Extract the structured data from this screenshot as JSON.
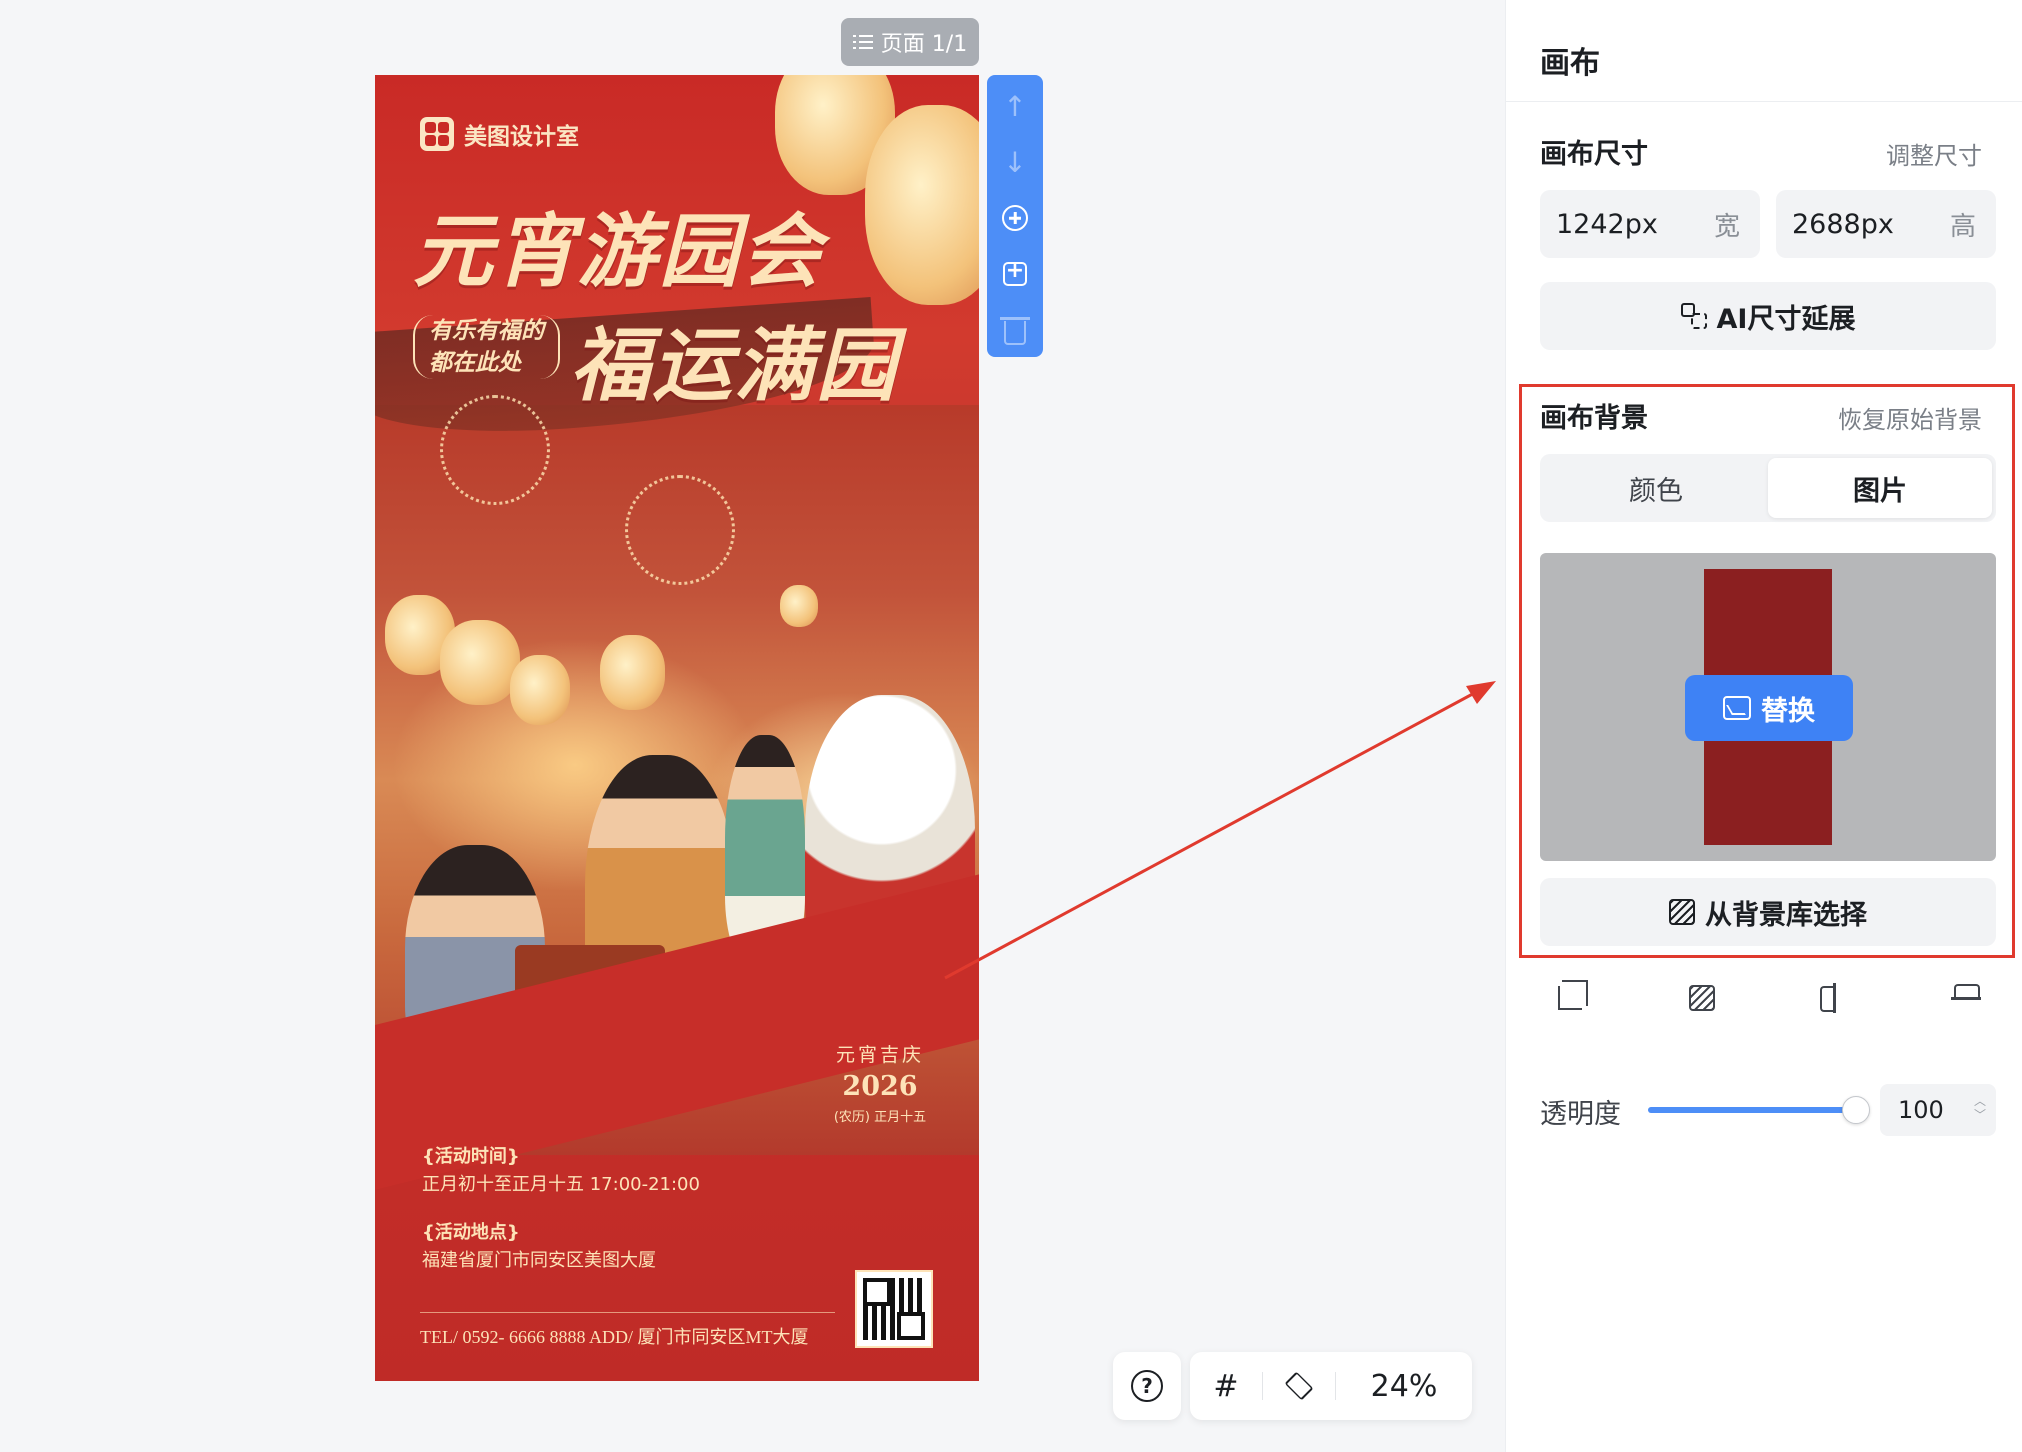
{
  "page_label": {
    "text": "页面 1/1"
  },
  "poster": {
    "brand": "美图设计室",
    "title_line1": "元宵游园会",
    "subtitle_line1": "有乐有福的",
    "subtitle_line2": "都在此处",
    "title_line2": "福运满园",
    "festival_seal": "元宵吉庆",
    "festival_year": "2026",
    "festival_date": "(农历) 正月十五",
    "time_heading": "{活动时间}",
    "time_value": "正月初十至正月十五 17:00-21:00",
    "place_heading": "{活动地点}",
    "place_value": "福建省厦门市同安区美图大厦",
    "footer": "TEL/ 0592- 6666 8888    ADD/ 厦门市同安区MT大厦"
  },
  "vertical_toolbar": {
    "icons": [
      "arrow-up-icon",
      "arrow-down-icon",
      "add-page-icon",
      "duplicate-icon",
      "trash-icon"
    ]
  },
  "bottom_bar": {
    "help": "?",
    "grid": "#",
    "zoom": "24%"
  },
  "panel": {
    "title": "画布",
    "size_section": {
      "title": "画布尺寸",
      "link": "调整尺寸",
      "width_value": "1242px",
      "width_unit": "宽",
      "height_value": "2688px",
      "height_unit": "高",
      "ai_button": "AI尺寸延展"
    },
    "background_section": {
      "title": "画布背景",
      "link": "恢复原始背景",
      "tabs": [
        "颜色",
        "图片"
      ],
      "active_tab": 1,
      "replace_button": "替换",
      "library_button": "从背景库选择",
      "thumbnail_color": "#8b1f20"
    },
    "opacity": {
      "label": "透明度",
      "value": "100",
      "level": 1.0
    },
    "accent_color": "#3e82f5",
    "annotation_color": "#e03a2e"
  }
}
